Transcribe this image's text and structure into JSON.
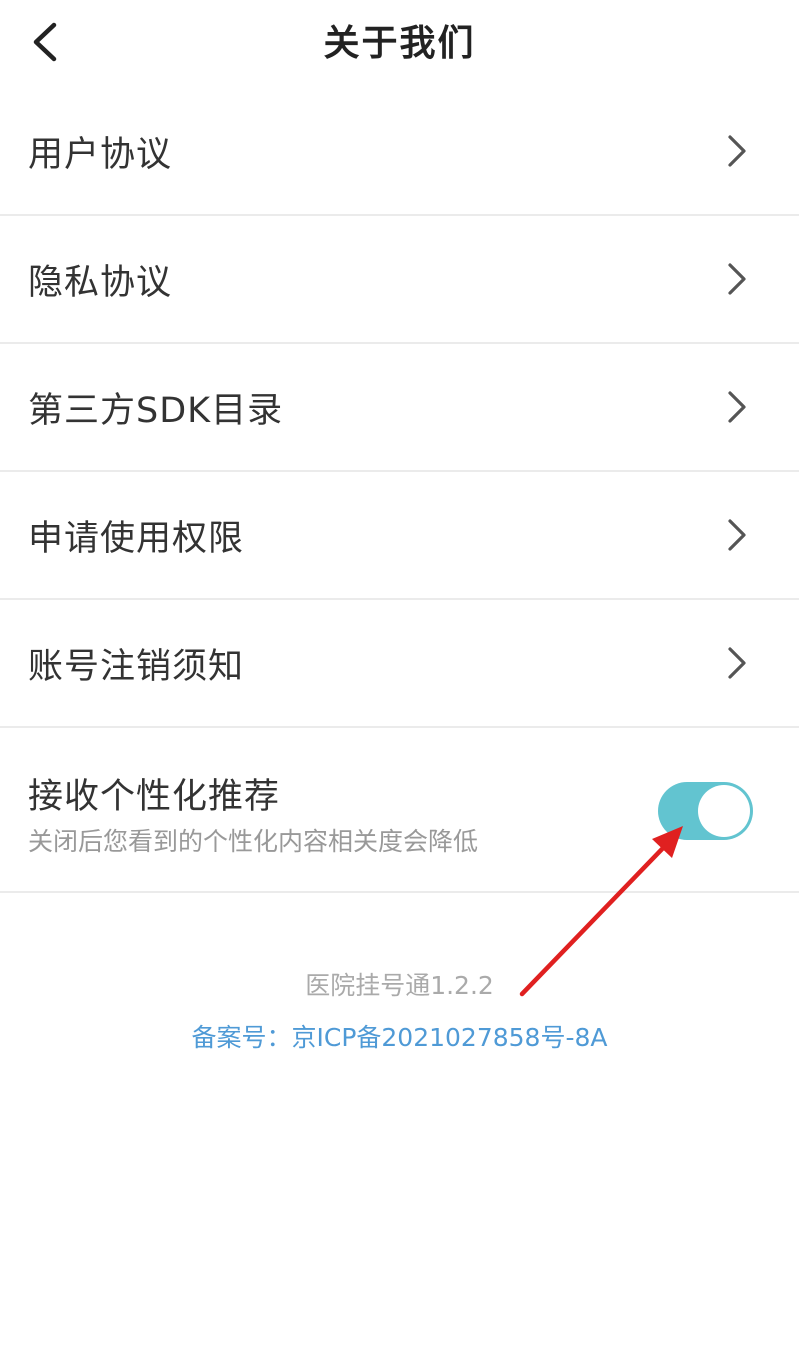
{
  "header": {
    "title": "关于我们",
    "back_icon": "chevron-left-icon"
  },
  "menu": {
    "items": [
      {
        "label": "用户协议"
      },
      {
        "label": "隐私协议"
      },
      {
        "label": "第三方SDK目录"
      },
      {
        "label": "申请使用权限"
      },
      {
        "label": "账号注销须知"
      }
    ],
    "chevron_icon": "chevron-right-icon"
  },
  "personalization": {
    "title": "接收个性化推荐",
    "description": "关闭后您看到的个性化内容相关度会降低",
    "enabled": true,
    "toggle_color": "#62c4d0"
  },
  "footer": {
    "version": "医院挂号通1.2.2",
    "icp": "备案号：京ICP备2021027858号-8A",
    "icp_color": "#4f9ad6"
  },
  "annotation": {
    "arrow_color": "#e02020"
  }
}
